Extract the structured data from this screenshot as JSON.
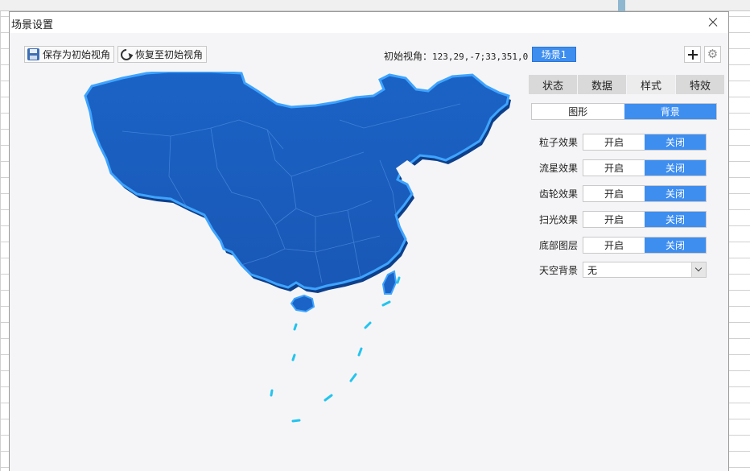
{
  "dialog": {
    "title": "场景设置"
  },
  "toolbar": {
    "save_label": "保存为初始视角",
    "restore_label": "恢复至初始视角",
    "view_label": "初始视角：",
    "view_value": "123,29,-7;33,351,0",
    "scene_label": "场景1"
  },
  "tabs": [
    {
      "label": "状态"
    },
    {
      "label": "数据"
    },
    {
      "label": "样式",
      "active": true
    },
    {
      "label": "特效"
    }
  ],
  "style_mode": {
    "shape_label": "图形",
    "background_label": "背景",
    "selected": "背景"
  },
  "effects": [
    {
      "label": "粒子效果",
      "on_label": "开启",
      "off_label": "关闭",
      "selected": "关闭"
    },
    {
      "label": "流星效果",
      "on_label": "开启",
      "off_label": "关闭",
      "selected": "关闭"
    },
    {
      "label": "齿轮效果",
      "on_label": "开启",
      "off_label": "关闭",
      "selected": "关闭"
    },
    {
      "label": "扫光效果",
      "on_label": "开启",
      "off_label": "关闭",
      "selected": "关闭"
    },
    {
      "label": "底部图层",
      "on_label": "开启",
      "off_label": "关闭",
      "selected": "关闭"
    }
  ],
  "sky": {
    "label": "天空背景",
    "value": "无"
  },
  "colors": {
    "accent": "#3e8ef0",
    "map_fill": "#1a5fbf",
    "map_edge": "#3ea4ff",
    "dash": "#23c4ee"
  },
  "icons": {
    "save": "save-icon",
    "restore": "refresh-icon",
    "add": "plus-icon",
    "settings": "gear-icon",
    "close": "close-icon",
    "dropdown": "chevron-down-icon"
  }
}
